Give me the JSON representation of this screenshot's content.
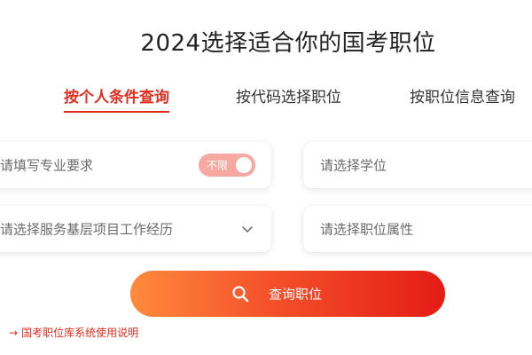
{
  "page": {
    "title": "2024选择适合你的国考职位"
  },
  "tabs": [
    {
      "label": "按个人条件查询",
      "active": true
    },
    {
      "label": "按代码选择职位",
      "active": false
    },
    {
      "label": "按职位信息查询",
      "active": false
    }
  ],
  "form": {
    "major": {
      "placeholder": "请填写专业要求",
      "toggle_label": "不限"
    },
    "degree": {
      "placeholder": "请选择学位"
    },
    "service": {
      "placeholder": "请选择服务基层项目工作经历",
      "icon": "chevron-down-icon"
    },
    "attribute": {
      "placeholder": "请选择职位属性"
    }
  },
  "search": {
    "label": "查询职位",
    "icon": "search-icon"
  },
  "help": {
    "arrow": "→",
    "label": "国考职位库系统使用说明"
  },
  "colors": {
    "accent": "#e02d1f",
    "toggle_bg": "#f6a9a0",
    "button_gradient_start": "#ff8a3d",
    "button_gradient_end": "#e41c15"
  }
}
